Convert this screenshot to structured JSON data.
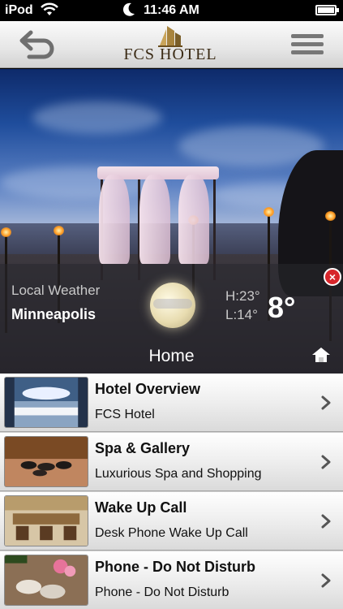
{
  "status_bar": {
    "carrier": "iPod",
    "time": "11:46 AM",
    "wifi_icon": "wifi-icon",
    "moon_icon": "moon-icon",
    "battery_icon": "battery-icon"
  },
  "nav": {
    "logo_text": "FCS HOTEL",
    "back_icon": "back-arrow-icon",
    "menu_icon": "hamburger-menu-icon"
  },
  "weather": {
    "label": "Local Weather",
    "city": "Minneapolis",
    "high": "H:23°",
    "low": "L:14°",
    "temperature": "8°",
    "icon": "moon-cloud-icon",
    "close_icon": "close-icon"
  },
  "home": {
    "title": "Home",
    "icon": "home-icon"
  },
  "items": [
    {
      "title": "Hotel Overview",
      "subtitle": "FCS Hotel"
    },
    {
      "title": "Spa & Gallery",
      "subtitle": "Luxurious Spa and Shopping"
    },
    {
      "title": "Wake Up Call",
      "subtitle": "Desk Phone Wake Up Call"
    },
    {
      "title": "Phone - Do Not Disturb",
      "subtitle": "Phone - Do Not Disturb"
    }
  ],
  "colors": {
    "close_badge": "#d7262b",
    "logo_gold": "#3a2a14"
  }
}
